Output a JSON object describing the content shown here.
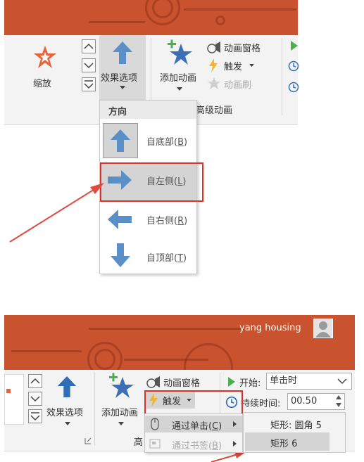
{
  "top": {
    "ribbon": {
      "zoom_label": "缩放",
      "effect_options_label": "效果选项",
      "add_animation_label": "添加动画",
      "animation_pane_label": "动画窗格",
      "trigger_label": "触发",
      "animation_painter_label": "动画刷",
      "advanced_animation_group": "高级动画"
    },
    "direction_menu": {
      "header": "方向",
      "items": [
        {
          "label": "自底部(",
          "key": "B",
          "suffix": ")"
        },
        {
          "label": "自左侧(",
          "key": "L",
          "suffix": ")"
        },
        {
          "label": "自右侧(",
          "key": "R",
          "suffix": ")"
        },
        {
          "label": "自顶部(",
          "key": "T",
          "suffix": ")"
        }
      ]
    }
  },
  "bottom": {
    "user_name": "yang housing",
    "ribbon": {
      "effect_options_label": "效果选项",
      "add_animation_label": "添加动画",
      "animation_pane_label": "动画窗格",
      "trigger_label": "触发",
      "advanced_group_partial": "高",
      "start_label": "开始:",
      "start_value": "单击时",
      "duration_label": "持续时间:",
      "duration_value": "00.50"
    },
    "trigger_menu": {
      "items": [
        {
          "label": "通过单击(",
          "key": "C",
          "suffix": ")"
        },
        {
          "label": "通过书签(",
          "key": "B",
          "suffix": ")"
        }
      ],
      "submenu": [
        "矩形: 圆角 5",
        "矩形 6"
      ]
    }
  },
  "colors": {
    "orange": "#c9532f",
    "blue_arrow": "#5b8fc7",
    "red_highlight": "#d9322b",
    "selected_bg": "#d4d4d4"
  }
}
